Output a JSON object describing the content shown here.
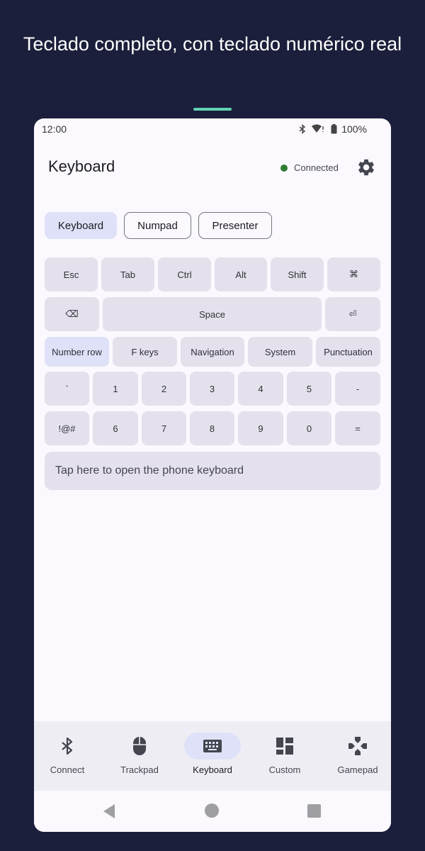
{
  "headline": "Teclado completo, con teclado numérico real",
  "status": {
    "time": "12:00",
    "battery": "100%"
  },
  "header": {
    "title": "Keyboard",
    "connection_status": "Connected",
    "connection_color": "#2e7d32"
  },
  "modes": [
    {
      "label": "Keyboard",
      "selected": true
    },
    {
      "label": "Numpad",
      "selected": false
    },
    {
      "label": "Presenter",
      "selected": false
    }
  ],
  "keys": {
    "row1": [
      "Esc",
      "Tab",
      "Ctrl",
      "Alt",
      "Shift",
      "⌘"
    ],
    "row2": [
      "⌫",
      "Space",
      "⏎"
    ],
    "row3": [
      "Number row",
      "F keys",
      "Navigation",
      "System",
      "Punctuation"
    ],
    "row4": [
      "`",
      "1",
      "2",
      "3",
      "4",
      "5",
      "-"
    ],
    "row5": [
      "!@#",
      "6",
      "7",
      "8",
      "9",
      "0",
      "="
    ]
  },
  "phone_keyboard_prompt": "Tap here to open the phone keyboard",
  "bottom_nav": [
    {
      "label": "Connect",
      "icon": "bluetooth-icon",
      "selected": false
    },
    {
      "label": "Trackpad",
      "icon": "mouse-icon",
      "selected": false
    },
    {
      "label": "Keyboard",
      "icon": "keyboard-icon",
      "selected": true
    },
    {
      "label": "Custom",
      "icon": "dashboard-icon",
      "selected": false
    },
    {
      "label": "Gamepad",
      "icon": "gamepad-icon",
      "selected": false
    }
  ],
  "colors": {
    "background": "#1c1f3b",
    "accent": "#5fd3b5",
    "selected": "#dfe1f8",
    "key": "#e4e1ec"
  }
}
